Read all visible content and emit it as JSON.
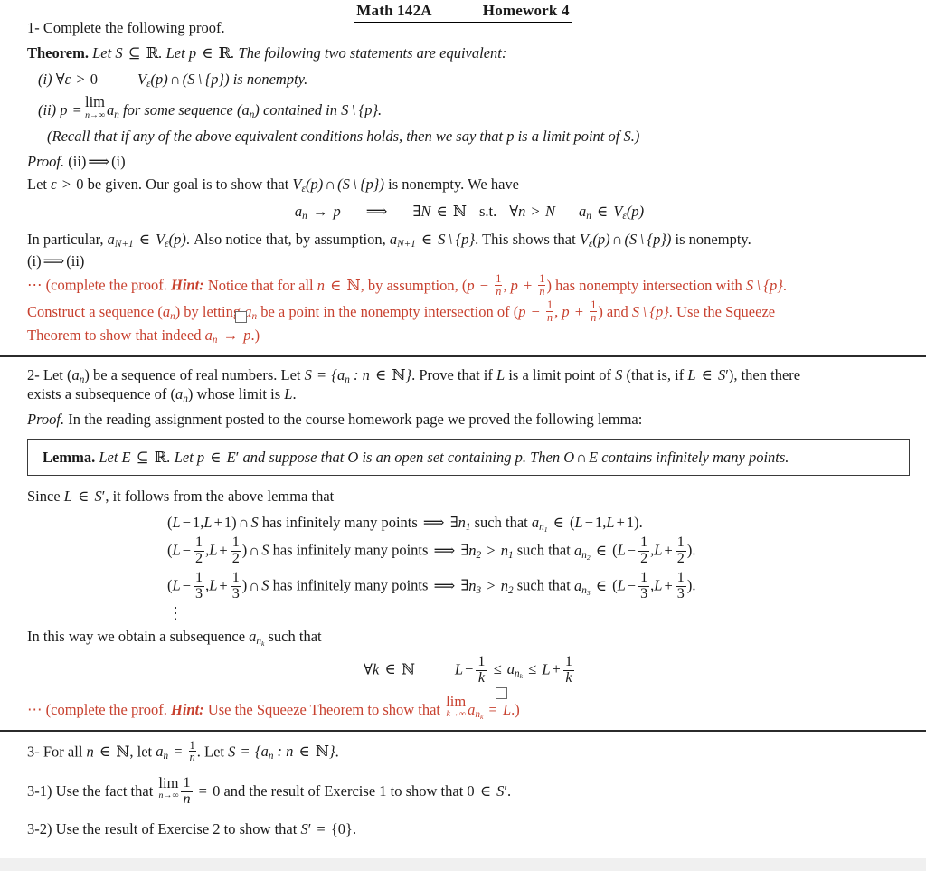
{
  "header": {
    "course": "Math 142A",
    "assignment": "Homework 4"
  },
  "problem1": {
    "prompt": "1- Complete the following proof.",
    "theorem_label": "Theorem.",
    "theorem_statement": "Let S ⊆ ℝ. Let p ∈ ℝ. The following two statements are equivalent:",
    "item_i_tag": "(i)",
    "item_i": "∀ε > 0    Vε(p) ∩ (S \\ {p}) is nonempty.",
    "item_ii_tag": "(ii)",
    "item_ii": "p = lim_{n→∞} aₙ for some sequence (aₙ) contained in S \\ {p}.",
    "recall": "(Recall that if any of the above equivalent conditions holds, then we say that p is a limit point of S.)",
    "proof_label": "Proof.",
    "direction_1": "(ii)⟹(i)",
    "given_line": "Let ε > 0 be given. Our goal is to show that Vε(p) ∩ (S \\ {p}) is nonempty. We have",
    "display_eq": "aₙ → p  ⟹  ∃N ∈ ℕ  s.t.  ∀n > N    aₙ ∈ Vε(p)",
    "in_particular": "In particular, a_{N+1} ∈ Vε(p). Also notice that, by assumption, a_{N+1} ∈ S \\ {p}. This shows that Vε(p) ∩ (S \\ {p}) is nonempty.",
    "direction_2": "(i)⟹(ii)",
    "hint_dots": "⋯",
    "hint_open": "(complete the proof.",
    "hint_label": "Hint:",
    "hint_line1": "Notice that for all n ∈ ℕ, by assumption, (p − 1/n, p + 1/n) has nonempty intersection with S \\ {p}.",
    "hint_line2": "Construct a sequence (aₙ) by letting aₙ be a point in the nonempty intersection of (p − 1/n, p + 1/n) and S \\ {p}. Use the Squeeze",
    "hint_line3": "Theorem to show that indeed aₙ → p.)",
    "qed": "□"
  },
  "problem2": {
    "prompt_line1": "2- Let (aₙ) be a sequence of real numbers. Let S = {aₙ : n ∈ ℕ}. Prove that if L is a limit point of S (that is, if L ∈ S′), then there",
    "prompt_line2": "exists a subsequence of (aₙ) whose limit is L.",
    "proof_label": "Proof.",
    "proof_intro": "In the reading assignment posted to the course homework page we proved the following lemma:",
    "lemma_label": "Lemma.",
    "lemma_statement": "Let E ⊆ ℝ. Let p ∈ E′ and suppose that O is an open set containing p. Then O ∩ E contains infinitely many points.",
    "since_line": "Since L ∈ S′, it follows from the above lemma that",
    "steps": [
      {
        "denominator": "1",
        "index": "1",
        "prev_index": "",
        "text_mid": "∩ S has infinitely many points",
        "arrow": "⟹",
        "exists_text": "such that"
      },
      {
        "denominator": "2",
        "index": "2",
        "prev_index": "1",
        "text_mid": "∩ S has infinitely many points",
        "arrow": "⟹",
        "exists_text": "such that"
      },
      {
        "denominator": "3",
        "index": "3",
        "prev_index": "2",
        "text_mid": "∩ S has infinitely many points",
        "arrow": "⟹",
        "exists_text": "such that"
      }
    ],
    "vdots": "⋮",
    "subseq_line": "In this way we obtain a subsequence a_{n_k} such that",
    "squeeze_display": "∀k ∈ ℕ    L − 1/k ≤ a_{n_k} ≤ L + 1/k",
    "hint_dots": "⋯",
    "hint_open": "(complete the proof.",
    "hint_label": "Hint:",
    "hint_text": "Use the Squeeze Theorem to show that lim_{k→∞} a_{n_k} = L.)",
    "qed": "□"
  },
  "problem3": {
    "prompt": "3- For all n ∈ ℕ, let aₙ = 1/n. Let S = {aₙ : n ∈ ℕ}.",
    "part1_tag": "3-1)",
    "part1": "Use the fact that lim_{n→∞} 1/n = 0 and the result of Exercise 1 to show that 0 ∈ S′.",
    "part2_tag": "3-2)",
    "part2": "Use the result of Exercise 2 to show that S′ = {0}."
  },
  "colors": {
    "hint_red": "#c8412f",
    "text": "#1a1a1a",
    "rule": "#2b2b2b",
    "qed_border": "#6a6a6a",
    "bottom_band": "#f0f0f0"
  }
}
